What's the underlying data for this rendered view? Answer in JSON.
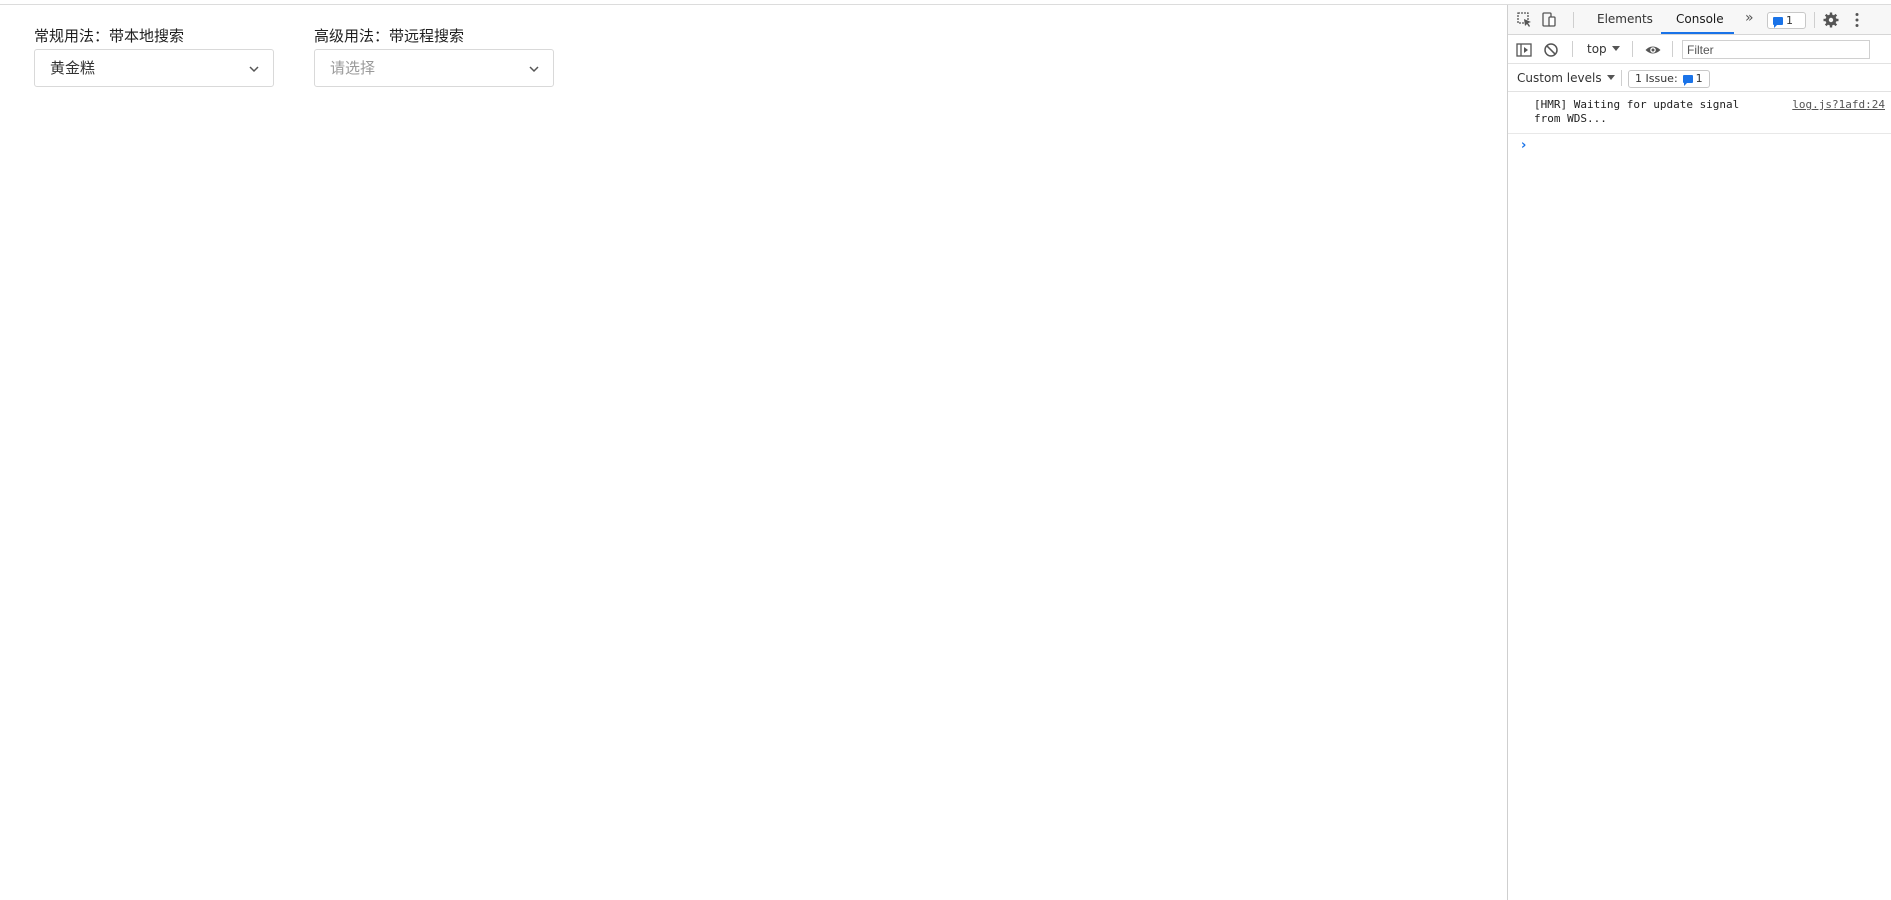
{
  "page": {
    "fields": [
      {
        "label": "常规用法：带本地搜索",
        "value": "黄金糕",
        "placeholder": ""
      },
      {
        "label": "高级用法：带远程搜索",
        "value": "",
        "placeholder": "请选择"
      }
    ]
  },
  "devtools": {
    "tabs": [
      "Elements",
      "Console"
    ],
    "active_tab": "Console",
    "message_badge_count": "1",
    "context": "top",
    "filter_placeholder": "Filter",
    "levels": "Custom levels",
    "issues_label": "1 Issue:",
    "issues_count": "1",
    "log": {
      "message": "[HMR] Waiting for update signal from WDS...",
      "source": "log.js?1afd:24"
    },
    "prompt": "›",
    "accent": "#1a73e8"
  }
}
